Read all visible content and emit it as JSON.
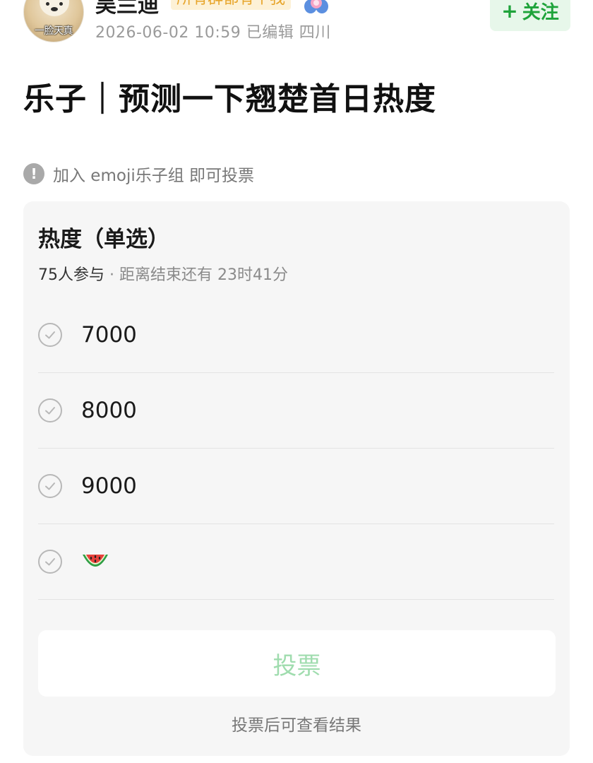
{
  "header": {
    "username": "吴兰迪",
    "badge": "所有群都有个我",
    "meta": "2026-06-02 10:59 已编辑 四川",
    "avatar_caption": "一脸天真",
    "follow_label": "关注",
    "follow_plus": "+"
  },
  "post": {
    "title": "乐子｜预测一下翘楚首日热度"
  },
  "notice": {
    "icon": "!",
    "text": "加入 emoji乐子组 即可投票"
  },
  "poll": {
    "title": "热度（单选）",
    "participants": "75人参与",
    "separator": " · ",
    "countdown": "距离结束还有 23时41分",
    "options": [
      {
        "label": "7000"
      },
      {
        "label": "8000"
      },
      {
        "label": "9000"
      },
      {
        "label": "",
        "icon": "watermelon-emoji"
      }
    ],
    "vote_label": "投票",
    "after_text": "投票后可查看结果"
  },
  "colors": {
    "accent_green": "#1ea33a",
    "badge_orange": "#e7a52a",
    "vote_disabled": "#9fdcae"
  }
}
